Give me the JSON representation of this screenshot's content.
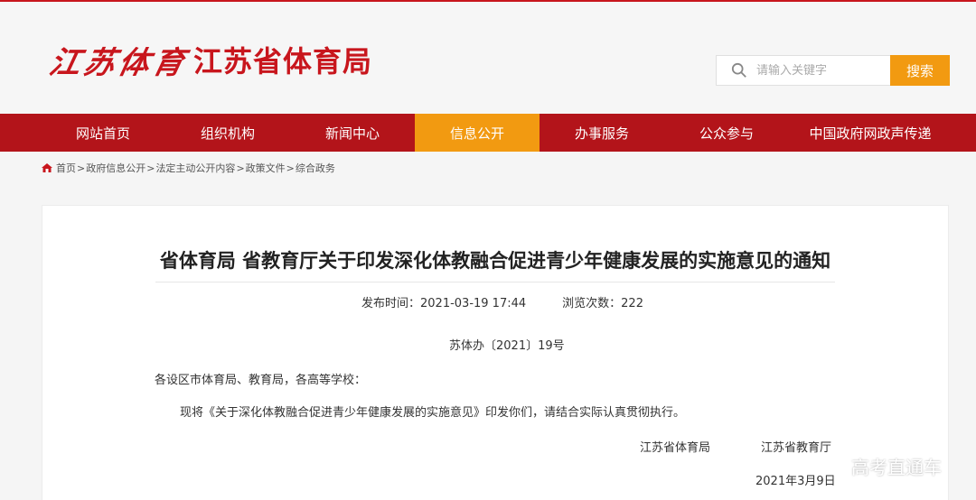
{
  "header": {
    "logo_script": "江苏体育",
    "logo_text": "江苏省体育局",
    "search_placeholder": "请输入关键字",
    "search_button": "搜索"
  },
  "nav": {
    "items": [
      {
        "label": "网站首页"
      },
      {
        "label": "组织机构"
      },
      {
        "label": "新闻中心"
      },
      {
        "label": "信息公开",
        "active": true
      },
      {
        "label": "办事服务"
      },
      {
        "label": "公众参与"
      },
      {
        "label": "中国政府网政声传递"
      }
    ]
  },
  "breadcrumb": {
    "items": [
      "首页",
      "政府信息公开",
      "法定主动公开内容",
      "政策文件",
      "综合政务"
    ],
    "separator": ">"
  },
  "article": {
    "title": "省体育局 省教育厅关于印发深化体教融合促进青少年健康发展的实施意见的通知",
    "publish_label": "发布时间：2021-03-19 17:44",
    "views_label": "浏览次数：222",
    "doc_number": "苏体办〔2021〕19号",
    "addressee": "各设区市体育局、教育局，各高等学校：",
    "body": "现将《关于深化体教融合促进青少年健康发展的实施意见》印发你们，请结合实际认真贯彻执行。",
    "signatory_1": "江苏省体育局",
    "signatory_2": "江苏省教育厅",
    "date": "2021年3月9日"
  },
  "watermark": "高考直通车",
  "colors": {
    "brand_red": "#c8161d",
    "nav_red": "#b3141a",
    "accent_orange": "#f29a11"
  }
}
